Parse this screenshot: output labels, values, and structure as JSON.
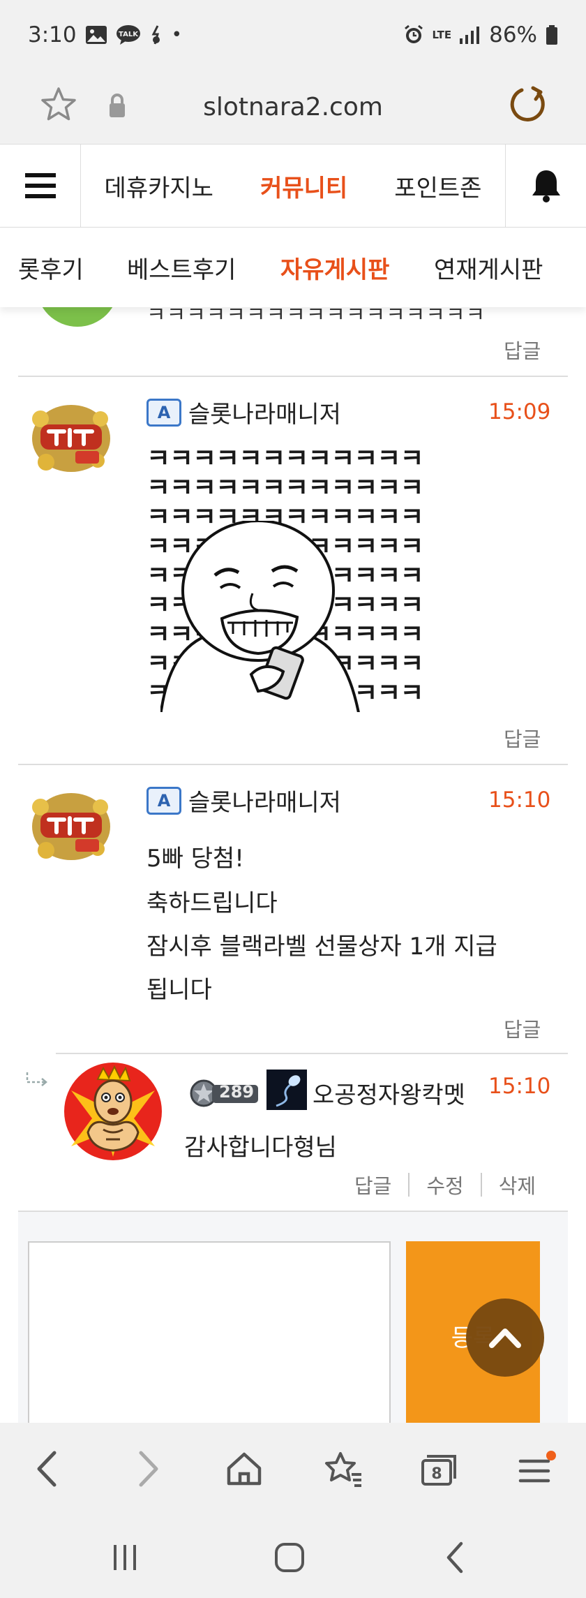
{
  "status_bar": {
    "time": "3:10",
    "talk_label": "TALK",
    "dot": "•",
    "network": "LTE",
    "battery": "86%"
  },
  "browser": {
    "url": "slotnara2.com",
    "bottom": {
      "tabs_count": "8"
    }
  },
  "site_nav": {
    "items": [
      {
        "label": "데휴카지노"
      },
      {
        "label": "커뮤니티"
      },
      {
        "label": "포인트존"
      }
    ]
  },
  "sub_nav": {
    "items": [
      {
        "label": "롯후기"
      },
      {
        "label": "베스트후기"
      },
      {
        "label": "자유게시판"
      },
      {
        "label": "연재게시판"
      }
    ]
  },
  "comments": {
    "clipped_text": "ㅋㅋㅋㅋㅋㅋㅋㅋㅋㅋㅋㅋㅋㅋㅋㅋㅋ",
    "reply_label": "답글",
    "c1": {
      "author": "슬롯나라매니저",
      "badge": "A",
      "time": "15:09",
      "meme_row": "ㅋㅋㅋㅋㅋㅋㅋㅋㅋㅋㅋㅋㅋ"
    },
    "c2": {
      "author": "슬롯나라매니저",
      "badge": "A",
      "time": "15:10",
      "lines": [
        "5빠 당첨!",
        "축하드립니다",
        "잠시후 블랙라벨 선물상자 1개 지급",
        "됩니다"
      ]
    },
    "c3": {
      "author": "오공정자왕칵멧",
      "level": "289",
      "time": "15:10",
      "text": "감사합니다형님",
      "actions": {
        "reply": "답글",
        "edit": "수정",
        "delete": "삭제"
      }
    }
  },
  "comment_form": {
    "submit_label": "등록"
  },
  "colors": {
    "accent": "#e8501a",
    "submit": "#f39619",
    "top_button": "#7a4a10",
    "badge_blue": "#3b77c8"
  }
}
